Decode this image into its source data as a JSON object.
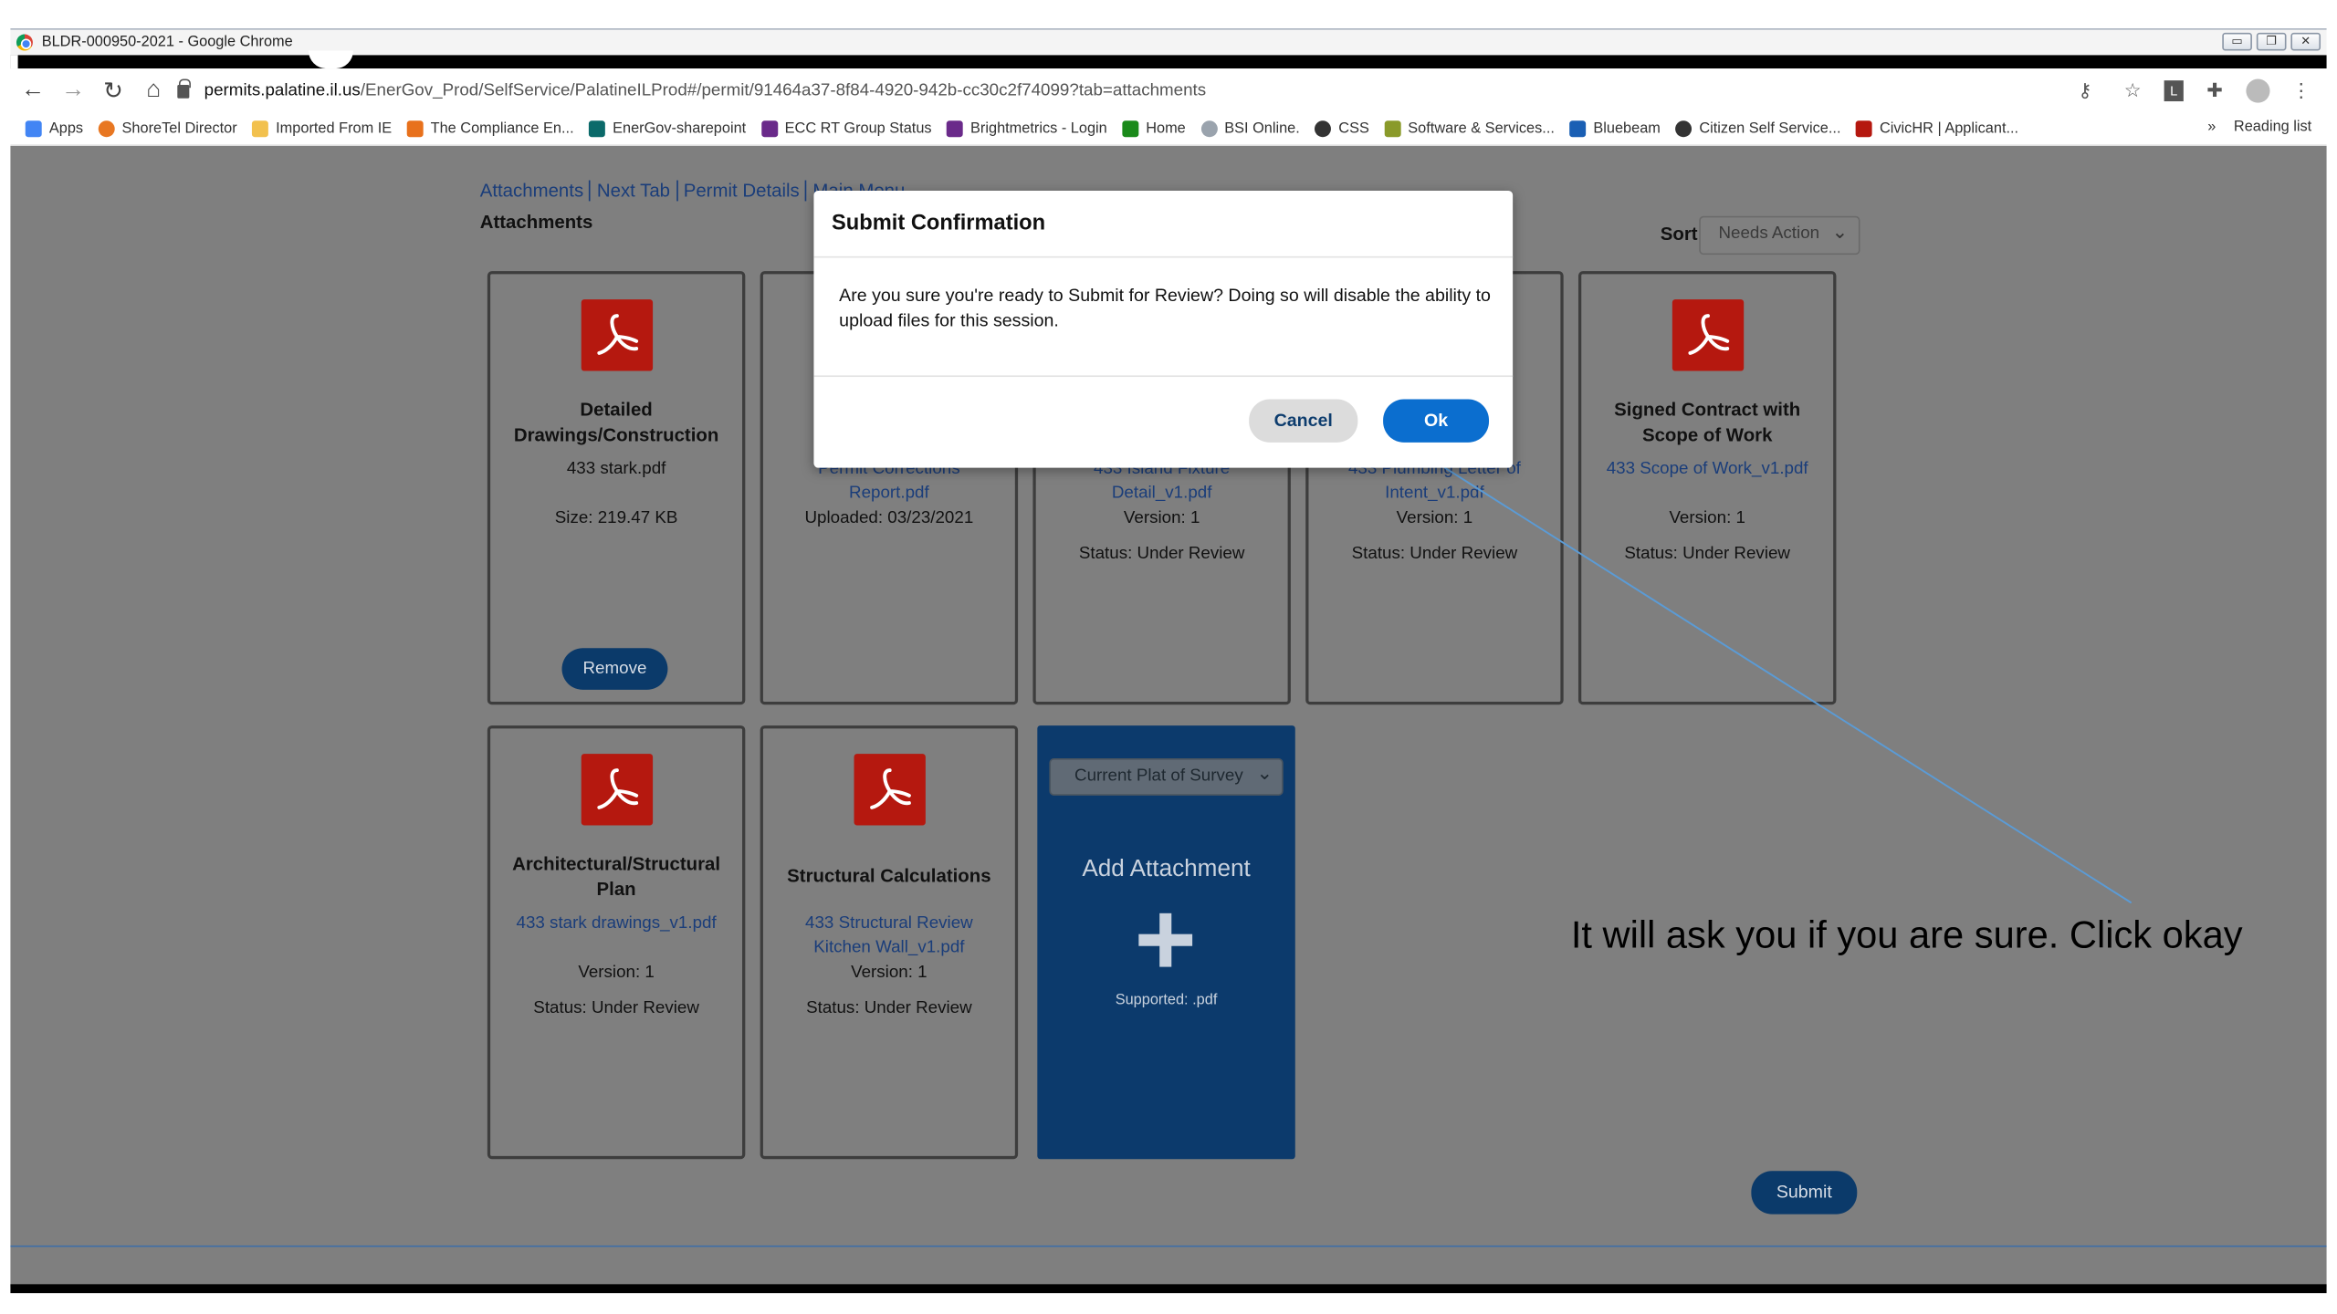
{
  "window": {
    "title": "BLDR-000950-2021 - Google Chrome"
  },
  "address": {
    "host": "permits.palatine.il.us",
    "path": "/EnerGov_Prod/SelfService/PalatineILProd#/permit/91464a37-8f84-4920-942b-cc30c2f74099?tab=attachments"
  },
  "bookmarks": [
    {
      "label": "Apps",
      "icon": "apps-grid-icon",
      "color": "#4285f4"
    },
    {
      "label": "ShoreTel Director",
      "icon": "shoretel-icon",
      "color": "#e87722"
    },
    {
      "label": "Imported From IE",
      "icon": "folder-icon",
      "color": "#f2c14e"
    },
    {
      "label": "The Compliance En...",
      "icon": "compliance-icon",
      "color": "#e8711c"
    },
    {
      "label": "EnerGov-sharepoint",
      "icon": "sharepoint-icon",
      "color": "#0b6a6a"
    },
    {
      "label": "ECC RT Group Status",
      "icon": "ecc-icon",
      "color": "#6a2a8a"
    },
    {
      "label": "Brightmetrics - Login",
      "icon": "brightmetrics-icon",
      "color": "#6a2a8a"
    },
    {
      "label": "Home",
      "icon": "home-icon",
      "color": "#1a8a1a"
    },
    {
      "label": "BSI Online.",
      "icon": "bsi-icon",
      "color": "#9aa3ad"
    },
    {
      "label": "CSS",
      "icon": "globe-icon",
      "color": "#333333"
    },
    {
      "label": "Software & Services...",
      "icon": "software-icon",
      "color": "#8a9a2a"
    },
    {
      "label": "Bluebeam",
      "icon": "bluebeam-icon",
      "color": "#1a5fb4"
    },
    {
      "label": "Citizen Self Service...",
      "icon": "globe-icon",
      "color": "#333333"
    },
    {
      "label": "CivicHR | Applicant...",
      "icon": "civichr-icon",
      "color": "#b5180f"
    }
  ],
  "bookmarks_more": "»",
  "reading_list": "Reading list",
  "breadcrumbs": [
    "Attachments",
    "Next Tab",
    "Permit Details",
    "Main Menu"
  ],
  "page_heading": "Attachments",
  "sort": {
    "label": "Sort",
    "value": "Needs Action"
  },
  "cards": [
    {
      "title": "Detailed Drawings/Construction",
      "lines": [
        {
          "text": "433 stark.pdf",
          "kind": "plain"
        },
        {
          "text": "Size: 219.47 KB",
          "kind": "plain"
        }
      ],
      "remove_label": "Remove"
    },
    {
      "title": "",
      "lines": [
        {
          "text": "Permit Corrections Report.pdf",
          "kind": "link"
        },
        {
          "text": "Uploaded: 03/23/2021",
          "kind": "plain"
        }
      ]
    },
    {
      "title": "",
      "lines": [
        {
          "text": "433 Island Fixture Detail_v1.pdf",
          "kind": "link"
        },
        {
          "text": "Version: 1",
          "kind": "plain"
        },
        {
          "text": "Status: Under Review",
          "kind": "plain"
        }
      ]
    },
    {
      "title": "",
      "lines": [
        {
          "text": "433 Plumbing Letter of Intent_v1.pdf",
          "kind": "link"
        },
        {
          "text": "Version: 1",
          "kind": "plain"
        },
        {
          "text": "Status: Under Review",
          "kind": "plain"
        }
      ]
    },
    {
      "title": "Signed Contract with Scope of Work",
      "lines": [
        {
          "text": "433 Scope of Work_v1.pdf",
          "kind": "link"
        },
        {
          "text": "Version: 1",
          "kind": "plain"
        },
        {
          "text": "Status: Under Review",
          "kind": "plain"
        }
      ]
    },
    {
      "title": "Architectural/Structural Plan",
      "lines": [
        {
          "text": "433 stark drawings_v1.pdf",
          "kind": "link"
        },
        {
          "text": "Version: 1",
          "kind": "plain"
        },
        {
          "text": "Status: Under Review",
          "kind": "plain"
        }
      ]
    },
    {
      "title": "Structural Calculations",
      "lines": [
        {
          "text": "433 Structural Review Kitchen Wall_v1.pdf",
          "kind": "link"
        },
        {
          "text": "Version: 1",
          "kind": "plain"
        },
        {
          "text": "Status: Under Review",
          "kind": "plain"
        }
      ]
    }
  ],
  "add_attachment": {
    "type_select": "Current Plat of Survey",
    "title": "Add Attachment",
    "supported": "Supported: .pdf"
  },
  "submit_label": "Submit",
  "modal": {
    "title": "Submit Confirmation",
    "message": "Are you sure you're ready to Submit for Review? Doing so will disable the ability to upload files for this session.",
    "cancel_label": "Cancel",
    "ok_label": "Ok"
  },
  "annotation": "It will ask you if you are sure. Click okay",
  "colors": {
    "brand_dark_blue": "#0b3a6a",
    "ok_blue": "#0b6ecf",
    "pdf_red": "#b5180f",
    "overlay_gray": "#7f7f7f",
    "arrow": "#5b9bd5"
  }
}
